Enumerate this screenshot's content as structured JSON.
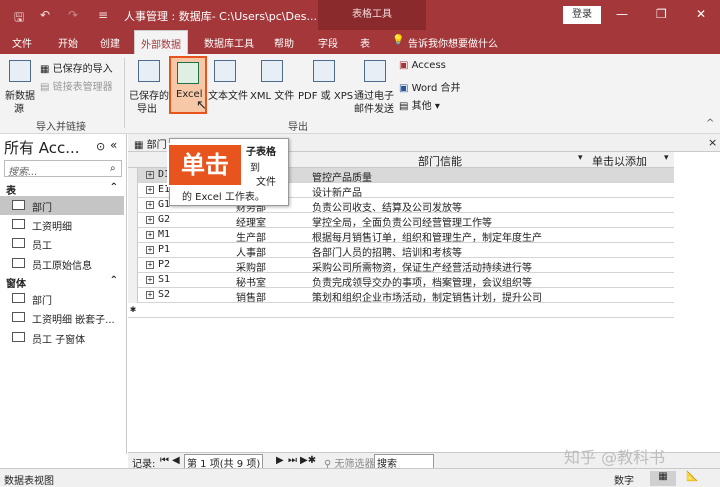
{
  "window": {
    "title": "人事管理 : 数据库- C:\\Users\\pc\\Des...",
    "context_tab": "表格工具",
    "login_button": "登录",
    "undo": "↶",
    "redo": "↷",
    "qa_more": "≡",
    "minimize": "—",
    "restore": "❐",
    "close": "✕"
  },
  "menu": {
    "items": [
      "文件",
      "开始",
      "创建",
      "外部数据",
      "数据库工具",
      "帮助",
      "字段",
      "表"
    ],
    "active_index": 3,
    "tell_me": "告诉我你想要做什么"
  },
  "ribbon": {
    "import_group": {
      "new_source_line1": "新数据",
      "new_source_line2": "源",
      "saved_imports": "已保存的导入",
      "linked_table_manager": "链接表管理器",
      "label": "导入并链接"
    },
    "export_group": {
      "saved_exports_line1": "已保存的",
      "saved_exports_line2": "导出",
      "excel": "Excel",
      "text_file": "文本文件",
      "xml_file": "XML 文件",
      "pdf_xps": "PDF 或 XPS",
      "email_line1": "通过电子",
      "email_line2": "邮件发送",
      "access": "Access",
      "word_merge": "Word 合并",
      "more": "其他",
      "label": "导出"
    },
    "collapse": "^"
  },
  "nav_pane": {
    "title": "所有 Acc...",
    "search_placeholder": "搜索...",
    "sections": [
      {
        "name": "表",
        "items": [
          "部门",
          "工资明细",
          "员工",
          "员工原始信息"
        ]
      },
      {
        "name": "窗体",
        "items": [
          "部门",
          "工资明细 嵌套子...",
          "员工 子窗体"
        ]
      }
    ],
    "selected": "部门"
  },
  "document": {
    "tab_label": "部门",
    "close": "×",
    "columns": [
      "",
      "部门信能",
      "单击以添加"
    ],
    "rows": [
      {
        "id": "D1",
        "name": "",
        "desc": "管控产品质量"
      },
      {
        "id": "E1",
        "name": "",
        "desc": "设计新产品"
      },
      {
        "id": "G1",
        "name": "财务部",
        "desc": "负责公司收支、结算及公司发放等"
      },
      {
        "id": "G2",
        "name": "经理室",
        "desc": "掌控全局，全面负责公司经营管理工作等"
      },
      {
        "id": "M1",
        "name": "生产部",
        "desc": "根据每月销售订单，组织和管理生产，制定年度生产"
      },
      {
        "id": "P1",
        "name": "人事部",
        "desc": "各部门人员的招聘、培训和考核等"
      },
      {
        "id": "P2",
        "name": "采购部",
        "desc": "采购公司所需物资，保证生产经营活动持续进行等"
      },
      {
        "id": "S1",
        "name": "秘书室",
        "desc": "负责完成领导交办的事项，档案管理，会议组织等"
      },
      {
        "id": "S2",
        "name": "销售部",
        "desc": "策划和组织企业市场活动，制定销售计划，提升公司"
      }
    ],
    "new_row_marker": "✱"
  },
  "tooltip": {
    "title": "导出到 Excel 电子表格",
    "line1": "将所选对象导出到",
    "line2": "Microsoft Excel 文件",
    "line3": "的 Excel 工作表。",
    "partial_title": "子表格",
    "partial_line1": "到",
    "partial_line2": "文件"
  },
  "annotation": {
    "label": "单击"
  },
  "record_nav": {
    "label": "记录:",
    "position": "第 1 项(共 9 项)",
    "filter": "无筛选器",
    "search": "搜索"
  },
  "status_bar": {
    "left": "数据表视图",
    "right": "数字"
  },
  "watermark": "知乎 @教科书"
}
